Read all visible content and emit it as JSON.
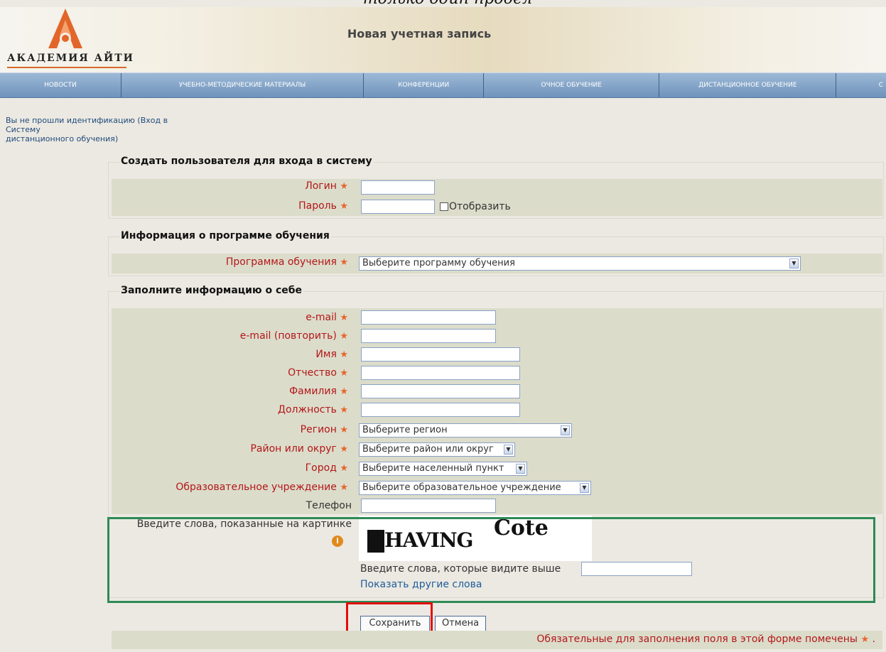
{
  "page": {
    "top_caption": "только один пробел",
    "title": "Новая учетная запись"
  },
  "logo": {
    "text": "АКАДЕМИЯ  АЙТИ"
  },
  "nav": {
    "items": [
      "НОВОСТИ",
      "УЧЕБНО-МЕТОДИЧЕСКИЕ МАТЕРИАЛЫ",
      "КОНФЕРЕНЦИИ",
      "ОЧНОЕ ОБУЧЕНИЕ",
      "ДИСТАНЦИОННОЕ ОБУЧЕНИЕ",
      "С"
    ]
  },
  "notice": {
    "line1": "Вы не прошли идентификацию (Вход в",
    "line2": "Систему",
    "line3": "дистанционного обучения)"
  },
  "section_account": {
    "legend": "Создать пользователя для входа в систему",
    "login_label": "Логин",
    "password_label": "Пароль",
    "show_label": "Отобразить"
  },
  "section_program": {
    "legend": "Информация о программе обучения",
    "program_label": "Программа обучения",
    "program_value": "Выберите программу обучения"
  },
  "section_about": {
    "legend": "Заполните информацию о себе",
    "email_label": "e-mail",
    "email_repeat_label": "e-mail (повторить)",
    "first_name_label": "Имя",
    "patronymic_label": "Отчество",
    "last_name_label": "Фамилия",
    "position_label": "Должность",
    "region_label": "Регион",
    "region_value": "Выберите регион",
    "district_label": "Район или округ",
    "district_value": "Выберите район или округ",
    "city_label": "Город",
    "city_value": "Выберите населенный пункт",
    "institution_label": "Образовательное учреждение",
    "institution_value": "Выберите образовательное учреждение",
    "phone_label": "Телефон"
  },
  "captcha": {
    "label": "Введите слова, показанные на картинке",
    "word1": "HAVING",
    "word2": "Cote",
    "input_label": "Введите слова, которые видите выше",
    "refresh_link": "Показать другие слова"
  },
  "buttons": {
    "save": "Сохранить",
    "cancel": "Отмена"
  },
  "footer": {
    "required_note": "Обязательные для заполнения поля в этой форме помечены"
  },
  "colors": {
    "required": "#b21818",
    "star": "#e7652d",
    "panel": "#dcdccb",
    "nav": "#6f93bb",
    "highlight_green": "#2e8a56",
    "highlight_red": "#e20d0d"
  }
}
